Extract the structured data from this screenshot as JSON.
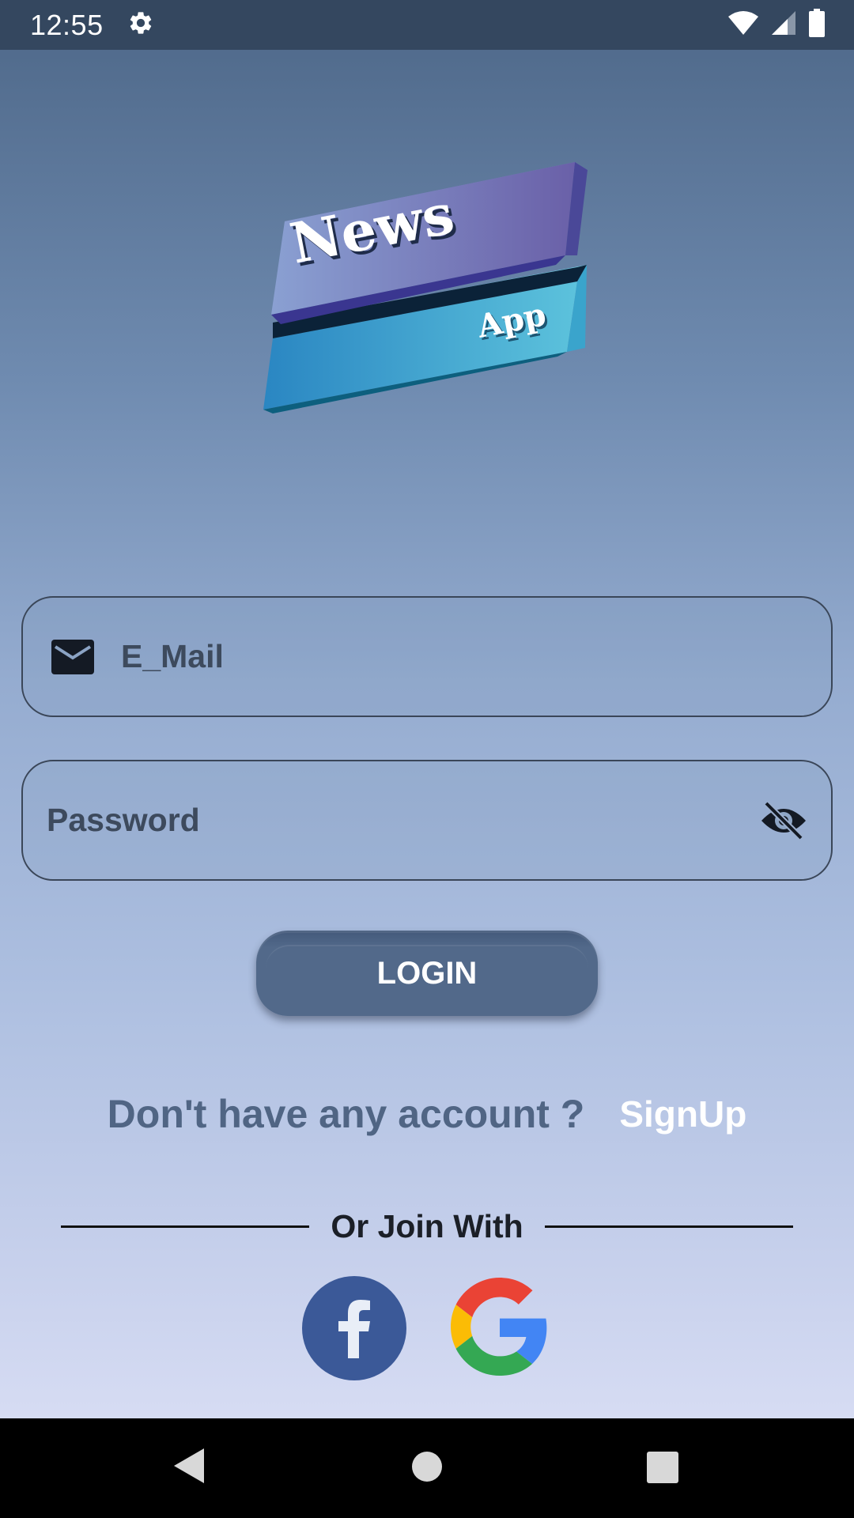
{
  "status_bar": {
    "time": "12:55",
    "icons": [
      "gear-icon",
      "wifi-icon",
      "cell-signal-icon",
      "battery-icon"
    ]
  },
  "logo": {
    "title": "News",
    "subtitle": "App"
  },
  "login_form": {
    "email": {
      "placeholder": "E_Mail",
      "value": "",
      "icon": "mail-icon"
    },
    "password": {
      "placeholder": "Password",
      "value": "",
      "icon": "eye-off-icon"
    },
    "login_label": "LOGIN"
  },
  "signup": {
    "prompt": "Don't have any account ?",
    "link": "SignUp"
  },
  "social": {
    "divider_label": "Or Join With",
    "providers": [
      "facebook-icon",
      "google-icon"
    ]
  },
  "nav_bar": {
    "buttons": [
      "back-icon",
      "home-icon",
      "recents-icon"
    ]
  },
  "colors": {
    "status_bar": "#34475f",
    "login_button": "#52698a",
    "signup_prompt": "#506584",
    "facebook": "#3b5998"
  }
}
